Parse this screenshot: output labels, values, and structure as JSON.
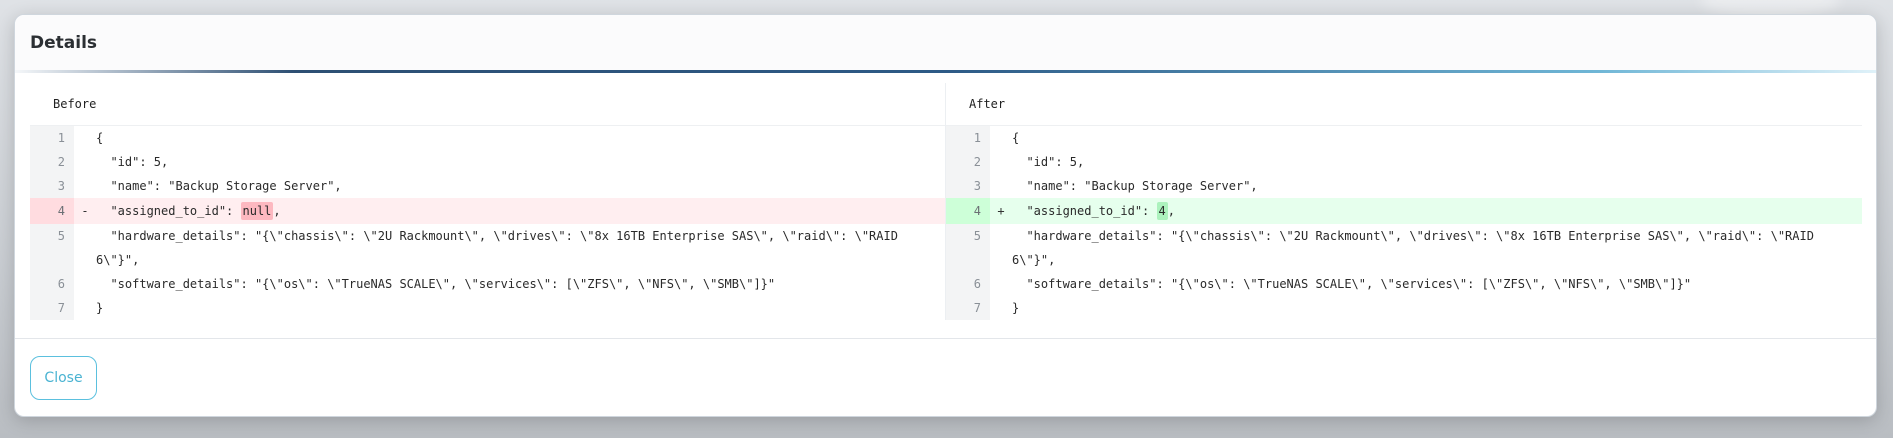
{
  "modal": {
    "title": "Details",
    "close_label": "Close"
  },
  "diff": {
    "before": {
      "title": "Before",
      "lines": [
        {
          "num": "1",
          "marker": "",
          "code": "{"
        },
        {
          "num": "2",
          "marker": "",
          "code": "  \"id\": 5,"
        },
        {
          "num": "3",
          "marker": "",
          "code": "  \"name\": \"Backup Storage Server\","
        },
        {
          "num": "4",
          "marker": "-",
          "code_prefix": "  \"assigned_to_id\": ",
          "code_changed": "null",
          "code_suffix": ","
        },
        {
          "num": "5",
          "marker": "",
          "code": "  \"hardware_details\": \"{\\\"chassis\\\": \\\"2U Rackmount\\\", \\\"drives\\\": \\\"8x 16TB Enterprise SAS\\\", \\\"raid\\\": \\\"RAID 6\\\"}\","
        },
        {
          "num": "6",
          "marker": "",
          "code": "  \"software_details\": \"{\\\"os\\\": \\\"TrueNAS SCALE\\\", \\\"services\\\": [\\\"ZFS\\\", \\\"NFS\\\", \\\"SMB\\\"]}\""
        },
        {
          "num": "7",
          "marker": "",
          "code": "}"
        }
      ]
    },
    "after": {
      "title": "After",
      "lines": [
        {
          "num": "1",
          "marker": "",
          "code": "{"
        },
        {
          "num": "2",
          "marker": "",
          "code": "  \"id\": 5,"
        },
        {
          "num": "3",
          "marker": "",
          "code": "  \"name\": \"Backup Storage Server\","
        },
        {
          "num": "4",
          "marker": "+",
          "code_prefix": "  \"assigned_to_id\": ",
          "code_changed": "4",
          "code_suffix": ","
        },
        {
          "num": "5",
          "marker": "",
          "code": "  \"hardware_details\": \"{\\\"chassis\\\": \\\"2U Rackmount\\\", \\\"drives\\\": \\\"8x 16TB Enterprise SAS\\\", \\\"raid\\\": \\\"RAID 6\\\"}\","
        },
        {
          "num": "6",
          "marker": "",
          "code": "  \"software_details\": \"{\\\"os\\\": \\\"TrueNAS SCALE\\\", \\\"services\\\": [\\\"ZFS\\\", \\\"NFS\\\", \\\"SMB\\\"]}\""
        },
        {
          "num": "7",
          "marker": "",
          "code": "}"
        }
      ]
    }
  },
  "colors": {
    "accent": "#5bc0de",
    "removed_bg": "#ffeef0",
    "removed_highlight": "#fdb8c0",
    "added_bg": "#e6ffed",
    "added_highlight": "#acf2bd"
  }
}
